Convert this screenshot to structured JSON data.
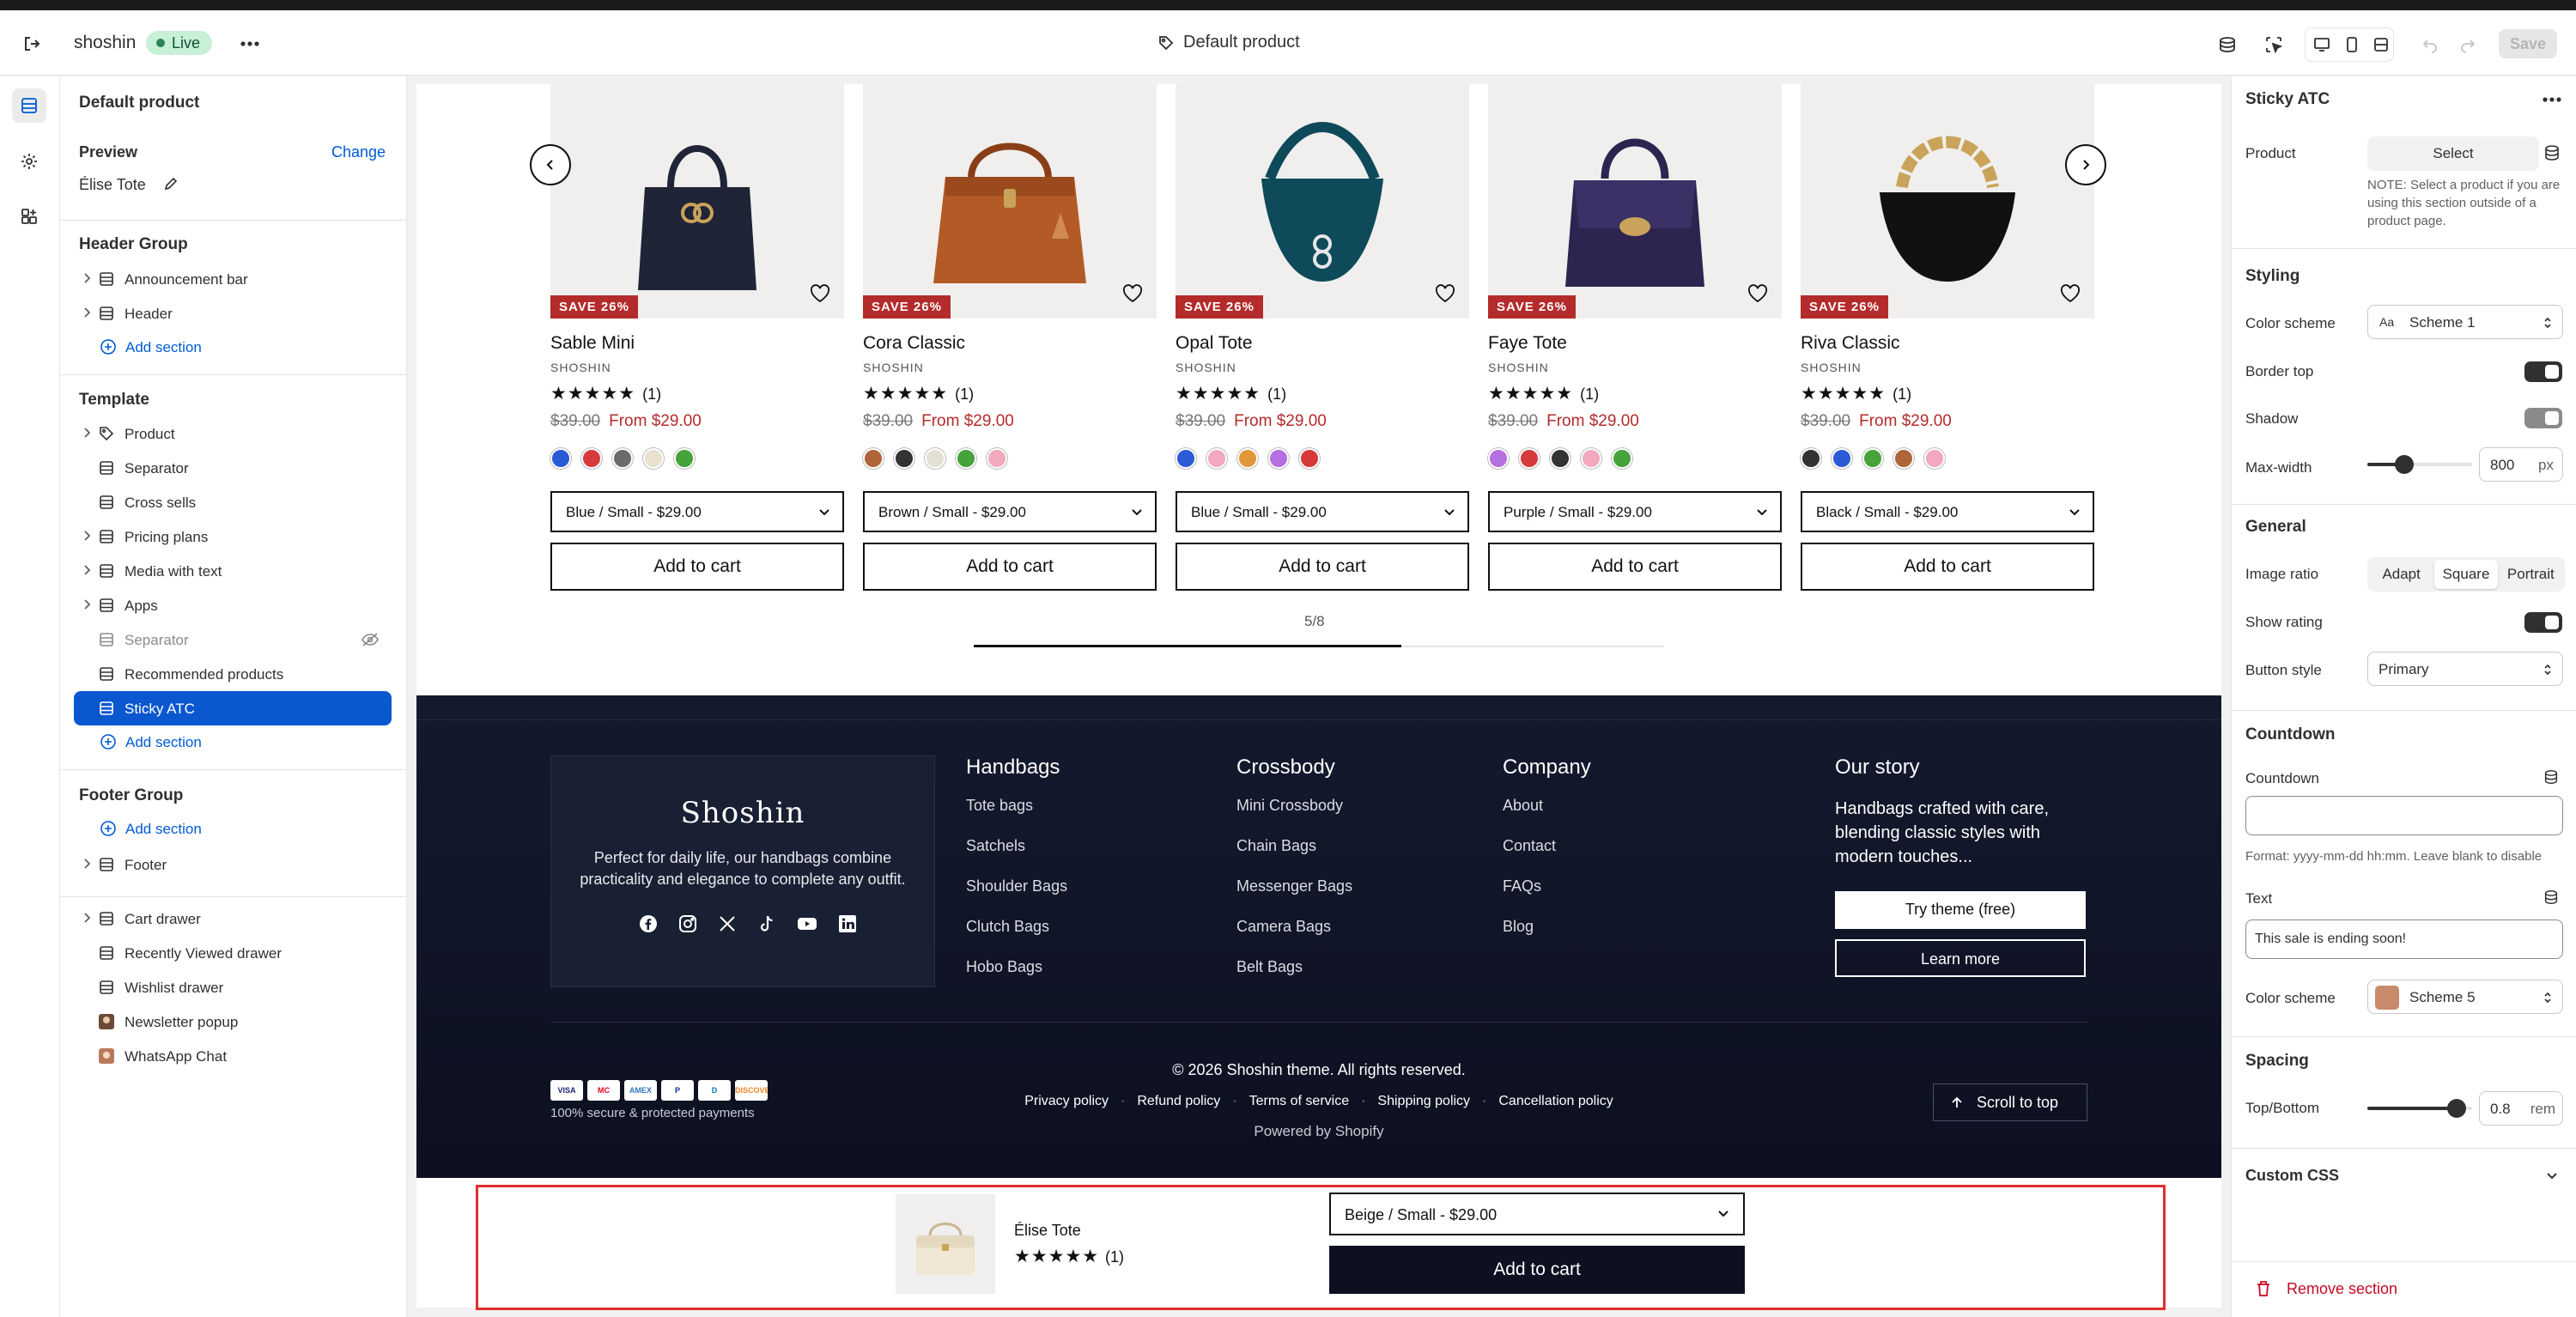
{
  "topbar": {
    "store_name": "shoshin",
    "status": "Live",
    "center_title": "Default product",
    "save_label": "Save"
  },
  "left_panel": {
    "title": "Default product",
    "preview_label": "Preview",
    "change_label": "Change",
    "preview_product": "Élise Tote",
    "header_group": {
      "title": "Header Group",
      "items": [
        {
          "label": "Announcement bar"
        },
        {
          "label": "Header"
        }
      ],
      "add_label": "Add section"
    },
    "template": {
      "title": "Template",
      "items": [
        {
          "label": "Product"
        },
        {
          "label": "Separator"
        },
        {
          "label": "Cross sells"
        },
        {
          "label": "Pricing plans"
        },
        {
          "label": "Media with text"
        },
        {
          "label": "Apps"
        },
        {
          "label": "Separator"
        },
        {
          "label": "Recommended products"
        },
        {
          "label": "Sticky ATC"
        }
      ],
      "add_label": "Add section"
    },
    "footer_group": {
      "title": "Footer Group",
      "add_label": "Add section",
      "items": [
        {
          "label": "Footer"
        }
      ]
    },
    "overlays": [
      {
        "label": "Cart drawer"
      },
      {
        "label": "Recently Viewed drawer"
      },
      {
        "label": "Wishlist drawer"
      },
      {
        "label": "Newsletter popup"
      },
      {
        "label": "WhatsApp Chat"
      }
    ]
  },
  "preview": {
    "products": [
      {
        "name": "Sable Mini",
        "vendor": "SHOSHIN",
        "badge": "SAVE 26%",
        "rating": "★★★★★",
        "reviews": "(1)",
        "compare": "$39.00",
        "price": "From $29.00",
        "variant": "Blue / Small - $29.00",
        "atc": "Add to cart",
        "swatches": [
          "#2a5bd7",
          "#d63a3a",
          "#6b6b6b",
          "#e8e1cf",
          "#45a33a"
        ],
        "bag_color": "#1f2437",
        "bag_shape": "tote"
      },
      {
        "name": "Cora Classic",
        "vendor": "SHOSHIN",
        "badge": "SAVE 26%",
        "rating": "★★★★★",
        "reviews": "(1)",
        "compare": "$39.00",
        "price": "From $29.00",
        "variant": "Brown / Small - $29.00",
        "atc": "Add to cart",
        "swatches": [
          "#b0643a",
          "#333333",
          "#e3e0d3",
          "#45a33a",
          "#f2a8bd"
        ],
        "bag_color": "#b35a26",
        "bag_shape": "satchel"
      },
      {
        "name": "Opal Tote",
        "vendor": "SHOSHIN",
        "badge": "SAVE 26%",
        "rating": "★★★★★",
        "reviews": "(1)",
        "compare": "$39.00",
        "price": "From $29.00",
        "variant": "Blue / Small - $29.00",
        "atc": "Add to cart",
        "swatches": [
          "#2a5bd7",
          "#f2a8bd",
          "#e0973a",
          "#b56fe0",
          "#d63a3a"
        ],
        "bag_color": "#0e4a5a",
        "bag_shape": "hobo"
      },
      {
        "name": "Faye Tote",
        "vendor": "SHOSHIN",
        "badge": "SAVE 26%",
        "rating": "★★★★★",
        "reviews": "(1)",
        "compare": "$39.00",
        "price": "From $29.00",
        "variant": "Purple / Small - $29.00",
        "atc": "Add to cart",
        "swatches": [
          "#b56fe0",
          "#d63a3a",
          "#333333",
          "#f2a8bd",
          "#45a33a"
        ],
        "bag_color": "#2d2450",
        "bag_shape": "flap"
      },
      {
        "name": "Riva Classic",
        "vendor": "SHOSHIN",
        "badge": "SAVE 26%",
        "rating": "★★★★★",
        "reviews": "(1)",
        "compare": "$39.00",
        "price": "From $29.00",
        "variant": "Black / Small - $29.00",
        "atc": "Add to cart",
        "swatches": [
          "#333333",
          "#2a5bd7",
          "#45a33a",
          "#b0643a",
          "#f2a8bd"
        ],
        "bag_color": "#111111",
        "bag_shape": "chain"
      }
    ],
    "pager": "5/8",
    "pager_progress": 0.62,
    "footer": {
      "brand": "Shoshin",
      "brand_text": "Perfect for daily life, our handbags combine practicality and elegance to complete any outfit.",
      "columns": [
        {
          "title": "Handbags",
          "links": [
            "Tote bags",
            "Satchels",
            "Shoulder Bags",
            "Clutch Bags",
            "Hobo Bags"
          ]
        },
        {
          "title": "Crossbody",
          "links": [
            "Mini Crossbody",
            "Chain Bags",
            "Messenger Bags",
            "Camera Bags",
            "Belt Bags"
          ]
        },
        {
          "title": "Company",
          "links": [
            "About",
            "Contact",
            "FAQs",
            "Blog"
          ]
        }
      ],
      "story_title": "Our story",
      "story_text": "Handbags crafted with care, blending classic styles with modern touches...",
      "try_label": "Try theme (free)",
      "learn_label": "Learn more",
      "copyright": "© 2026 Shoshin theme. All rights reserved.",
      "policies": [
        "Privacy policy",
        "Refund policy",
        "Terms of service",
        "Shipping policy",
        "Cancellation policy"
      ],
      "powered": "Powered by Shopify",
      "secure": "100% secure & protected payments",
      "payments": [
        "VISA",
        "MC",
        "AMEX",
        "P",
        "D",
        "DISCOVER"
      ],
      "scroll_top": "Scroll to top"
    },
    "sticky": {
      "product": "Élise Tote",
      "rating": "★★★★★",
      "reviews": "(1)",
      "variant": "Beige / Small - $29.00",
      "atc": "Add to cart"
    }
  },
  "right_panel": {
    "title": "Sticky ATC",
    "product_label": "Product",
    "select_label": "Select",
    "product_note": "NOTE: Select a product if you are using this section outside of a product page.",
    "styling_title": "Styling",
    "color_scheme_label": "Color scheme",
    "color_scheme_value": "Scheme 1",
    "border_top_label": "Border top",
    "border_top": true,
    "shadow_label": "Shadow",
    "shadow": false,
    "max_width_label": "Max-width",
    "max_width_value": "800",
    "max_width_unit": "px",
    "max_width_level": 0.35,
    "general_title": "General",
    "image_ratio_label": "Image ratio",
    "image_ratio_options": [
      "Adapt",
      "Square",
      "Portrait"
    ],
    "image_ratio_selected": "Square",
    "show_rating_label": "Show rating",
    "show_rating": true,
    "button_style_label": "Button style",
    "button_style_value": "Primary",
    "countdown_title": "Countdown",
    "countdown_label": "Countdown",
    "countdown_value": "",
    "countdown_hint": "Format: yyyy-mm-dd hh:mm. Leave blank to disable",
    "text_label": "Text",
    "text_value": "This sale is ending soon!",
    "color_scheme2_label": "Color scheme",
    "color_scheme2_value": "Scheme 5",
    "spacing_title": "Spacing",
    "spacing_label": "Top/Bottom",
    "spacing_value": "0.8",
    "spacing_unit": "rem",
    "spacing_level": 0.85,
    "custom_css_label": "Custom CSS",
    "remove_label": "Remove section"
  }
}
